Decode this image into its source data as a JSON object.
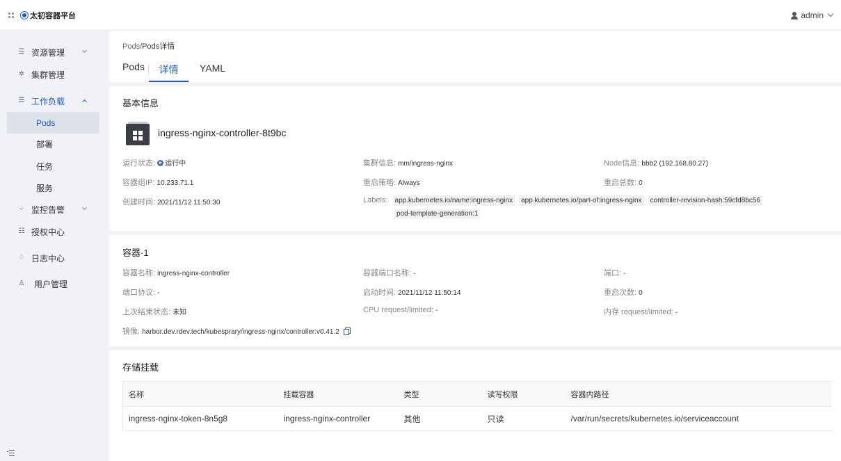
{
  "topbar": {
    "title": "太初容器平台",
    "user": "admin"
  },
  "sidebar": {
    "items": [
      {
        "label": "资源管理",
        "icon": "sliders-icon"
      },
      {
        "label": "集群管理",
        "icon": "cluster-icon"
      },
      {
        "label": "工作负载",
        "icon": "workload-icon"
      },
      {
        "label": "监控告警",
        "icon": "monitor-icon"
      },
      {
        "label": "授权中心",
        "icon": "auth-icon"
      },
      {
        "label": "日志中心",
        "icon": "bell-icon"
      },
      {
        "label": "用户管理",
        "icon": "user-icon"
      }
    ],
    "subitems": [
      "Pods",
      "部署",
      "任务",
      "服务"
    ]
  },
  "breadcrumb": {
    "parent": "Pods",
    "sep": "/",
    "current": "Pods详情"
  },
  "tabs": [
    "Pods",
    "详情",
    "YAML"
  ],
  "basic": {
    "title": "基本信息",
    "pod_name": "ingress-nginx-controller-8t9bc",
    "status_label": "运行状态:",
    "status_value": "运行中",
    "cluster_label": "集群信息:",
    "cluster_value": "mm/ingress-nginx",
    "node_label": "Node信息:",
    "node_value": "bbb2 (192.168.80.27)",
    "ip_label": "容器组IP:",
    "ip_value": "10.233.71.1",
    "restart_policy_label": "重启策略:",
    "restart_policy_value": "Always",
    "restart_total_label": "重启总数:",
    "restart_total_value": "0",
    "created_label": "创建时间:",
    "created_value": "2021/11/12 11:50:30",
    "labels_label": "Labels:",
    "labels": [
      "app.kubernetes.io/name:ingress-nginx",
      "app.kubernetes.io/part-of:ingress-nginx",
      "controller-revision-hash:59cfd8bc56",
      "pod-template-generation:1"
    ]
  },
  "container": {
    "title": "容器·1",
    "name_label": "容器名称:",
    "name_value": "ingress-nginx-controller",
    "port_name_label": "容器端口名称:",
    "port_name_value": "-",
    "port_label": "端口:",
    "port_value": "-",
    "protocol_label": "端口协议:",
    "protocol_value": "-",
    "start_label": "启动时间:",
    "start_value": "2021/11/12 11:50:14",
    "restarts_label": "重启次数:",
    "restarts_value": "0",
    "last_state_label": "上次结束状态:",
    "last_state_value": "未知",
    "cpu_label": "CPU request/limited:",
    "cpu_value": "-",
    "mem_label": "内存 request/limited:",
    "mem_value": "-",
    "image_label": "镜像:",
    "image_value": "harbor.dev.rdev.tech/kubesprary/ingress-nginx/controller:v0.41.2"
  },
  "storage": {
    "title": "存储挂载",
    "columns": [
      "名称",
      "挂载容器",
      "类型",
      "读写权限",
      "容器内路径"
    ],
    "rows": [
      [
        "ingress-nginx-token-8n5g8",
        "ingress-nginx-controller",
        "其他",
        "只读",
        "/var/run/secrets/kubernetes.io/serviceaccount"
      ]
    ]
  },
  "colors": {
    "accent": "#1f5fbf",
    "background": "#f0f2f5"
  }
}
